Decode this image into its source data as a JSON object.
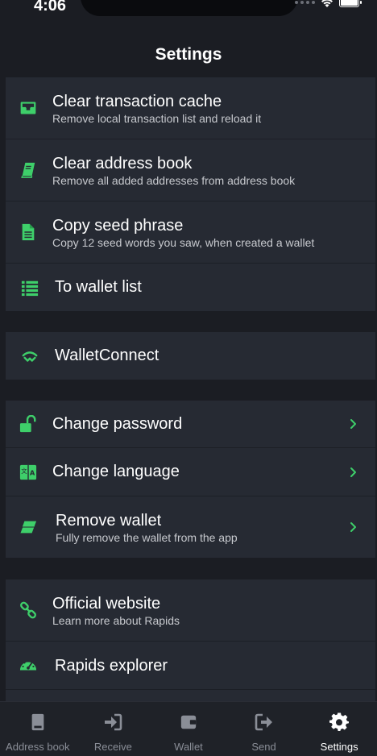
{
  "status": {
    "time": "4:06"
  },
  "header": {
    "title": "Settings"
  },
  "colors": {
    "accent": "#3ecf6a",
    "background": "#1b1d23",
    "card": "#262a33",
    "muted": "#8a8e97"
  },
  "groups": [
    {
      "items": [
        {
          "icon": "inbox-tray-icon",
          "title": "Clear transaction cache",
          "subtitle": "Remove local transaction list and reload it"
        },
        {
          "icon": "book-icon",
          "title": "Clear address book",
          "subtitle": "Remove all added addresses from address book"
        },
        {
          "icon": "document-icon",
          "title": "Copy seed phrase",
          "subtitle": "Copy 12 seed words you saw, when created a wallet"
        },
        {
          "icon": "list-icon",
          "title": "To wallet list"
        }
      ]
    },
    {
      "items": [
        {
          "icon": "walletconnect-icon",
          "title": "WalletConnect"
        }
      ]
    },
    {
      "items": [
        {
          "icon": "unlock-icon",
          "title": "Change password",
          "chevron": true
        },
        {
          "icon": "language-icon",
          "title": "Change language",
          "chevron": true
        },
        {
          "icon": "eraser-icon",
          "title": "Remove wallet",
          "subtitle": "Fully remove the wallet from the app",
          "chevron": true
        }
      ]
    },
    {
      "items": [
        {
          "icon": "link-icon",
          "title": "Official website",
          "subtitle": "Learn more about Rapids"
        },
        {
          "icon": "speedometer-icon",
          "title": "Rapids explorer"
        }
      ]
    }
  ],
  "tabs": [
    {
      "icon": "book-icon",
      "label": "Address book"
    },
    {
      "icon": "receive-icon",
      "label": "Receive"
    },
    {
      "icon": "wallet-icon",
      "label": "Wallet"
    },
    {
      "icon": "send-icon",
      "label": "Send"
    },
    {
      "icon": "gear-icon",
      "label": "Settings",
      "active": true
    }
  ]
}
